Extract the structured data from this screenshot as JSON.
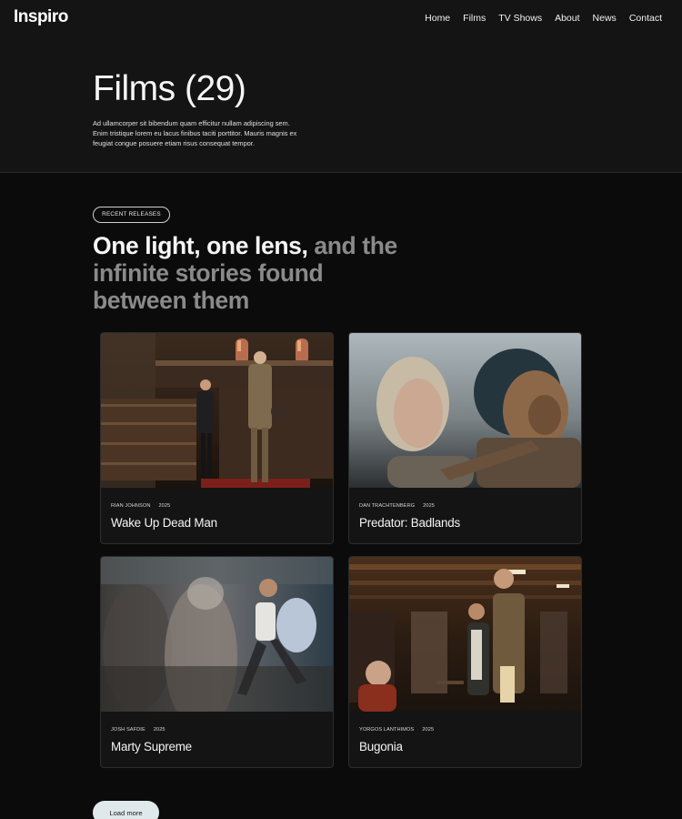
{
  "header": {
    "logo": "Inspiro",
    "nav": [
      "Home",
      "Films",
      "TV Shows",
      "About",
      "News",
      "Contact"
    ]
  },
  "hero": {
    "title": "Films (29)",
    "description": "Ad ullamcorper sit bibendum quam efficitur nullam adipiscing sem. Enim tristique lorem eu lacus finibus taciti porttitor. Mauris magnis ex feugiat congue posuere etiam risus consequat tempor."
  },
  "section": {
    "tag": "RECENT RELEASES",
    "headline_bright": "One light, one lens,",
    "headline_dim": "and the infinite stories found between them"
  },
  "films": [
    {
      "director": "RIAN JOHNSON",
      "year": "2025",
      "title": "Wake Up Dead Man"
    },
    {
      "director": "DAN TRACHTENBERG",
      "year": "2025",
      "title": "Predator: Badlands"
    },
    {
      "director": "JOSH SAFDIE",
      "year": "2025",
      "title": "Marty Supreme"
    },
    {
      "director": "YORGOS LANTHIMOS",
      "year": "2025",
      "title": "Bugonia"
    }
  ],
  "load_more": "Load more"
}
